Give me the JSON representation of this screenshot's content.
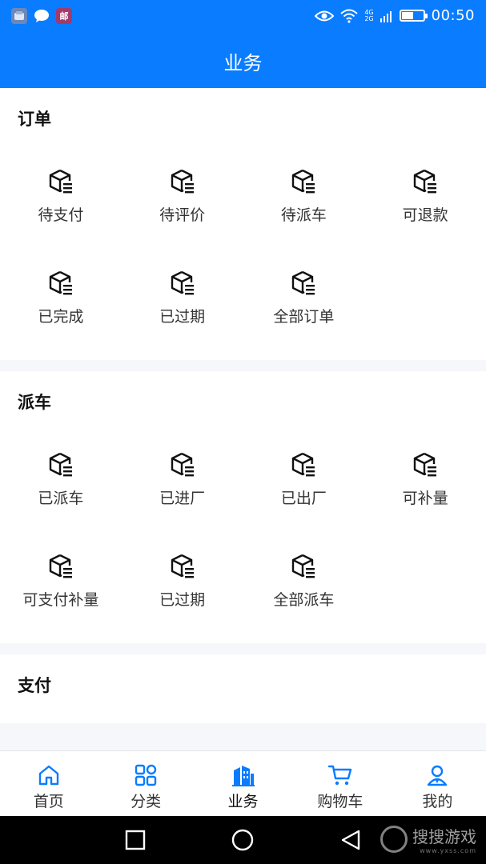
{
  "status_bar": {
    "time": "00:50",
    "network_top": "4G",
    "network_bottom": "2G",
    "app_badge_3": "邮",
    "battery_level": 0.6
  },
  "header": {
    "title": "业务"
  },
  "sections": [
    {
      "title": "订单",
      "items": [
        "待支付",
        "待评价",
        "待派车",
        "可退款",
        "已完成",
        "已过期",
        "全部订单"
      ]
    },
    {
      "title": "派车",
      "items": [
        "已派车",
        "已进厂",
        "已出厂",
        "可补量",
        "可支付补量",
        "已过期",
        "全部派车"
      ]
    },
    {
      "title": "支付",
      "items": []
    }
  ],
  "bottom_nav": {
    "items": [
      {
        "label": "首页",
        "icon": "home-icon"
      },
      {
        "label": "分类",
        "icon": "grid-icon"
      },
      {
        "label": "业务",
        "icon": "business-icon"
      },
      {
        "label": "购物车",
        "icon": "cart-icon"
      },
      {
        "label": "我的",
        "icon": "user-icon"
      }
    ],
    "active_index": 2
  },
  "watermark": {
    "text": "搜搜游戏",
    "sub": "www.yxss.com"
  },
  "colors": {
    "primary": "#0a7cff",
    "text": "#333333",
    "background": "#f5f7fb"
  }
}
